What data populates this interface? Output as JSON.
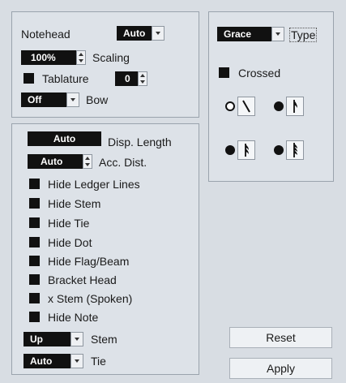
{
  "notehead": {
    "label": "Notehead",
    "value": "Auto",
    "scaling_value": "100%",
    "scaling_label": "Scaling",
    "tablature_label": "Tablature",
    "tablature_value": "0",
    "bow_value": "Off",
    "bow_label": "Bow"
  },
  "stem_panel": {
    "disp_length_value": "Auto",
    "disp_length_label": "Disp. Length",
    "acc_dist_value": "Auto",
    "acc_dist_label": "Acc. Dist.",
    "checkboxes": [
      "Hide Ledger Lines",
      "Hide Stem",
      "Hide Tie",
      "Hide Dot",
      "Hide Flag/Beam",
      "Bracket Head",
      "x Stem (Spoken)",
      "Hide Note"
    ],
    "stem_value": "Up",
    "stem_label": "Stem",
    "tie_value": "Auto",
    "tie_label": "Tie"
  },
  "grace_panel": {
    "type_value": "Grace",
    "type_label": "Type",
    "crossed_label": "Crossed"
  },
  "buttons": {
    "reset": "Reset",
    "apply": "Apply"
  }
}
